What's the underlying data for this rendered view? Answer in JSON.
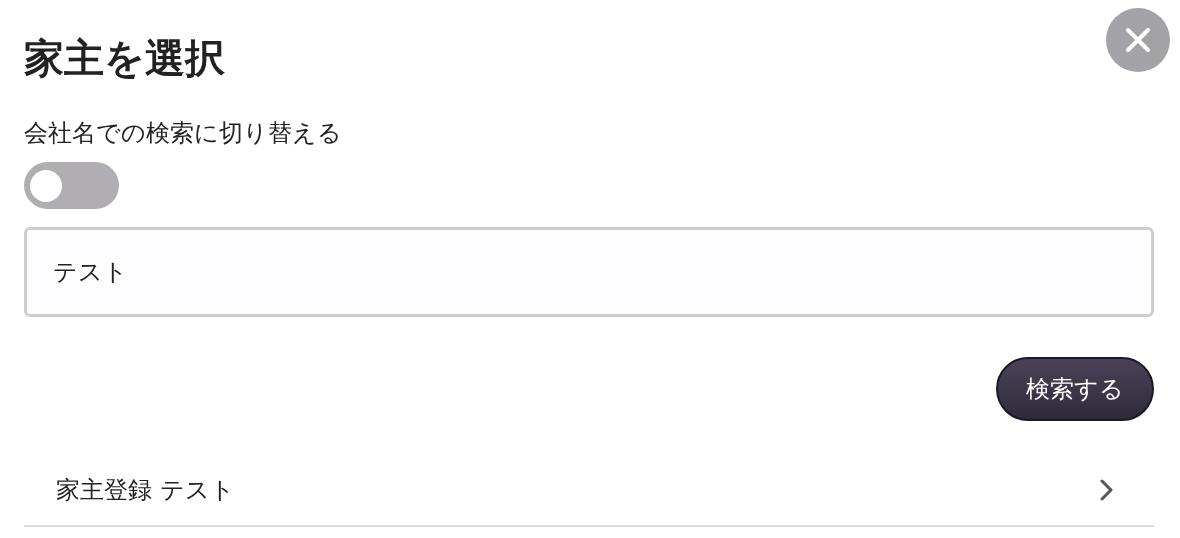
{
  "dialog": {
    "title": "家主を選択"
  },
  "toggle": {
    "label": "会社名での検索に切り替える",
    "on": false
  },
  "search": {
    "value": "テスト"
  },
  "search_button": {
    "label": "検索する"
  },
  "results": [
    {
      "label": "家主登録 テスト"
    }
  ]
}
